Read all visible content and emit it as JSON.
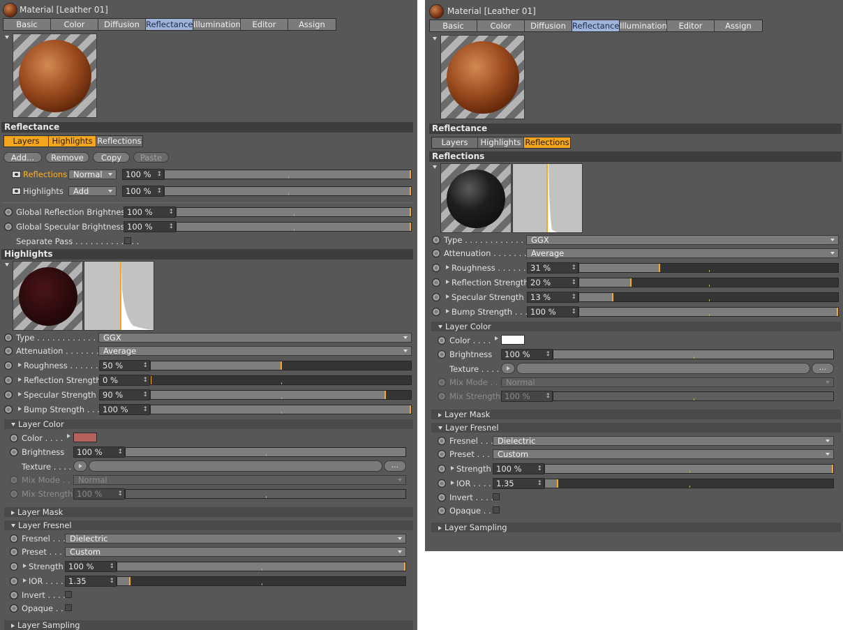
{
  "material_title": "Material [Leather 01]",
  "tabs": [
    "Basic",
    "Color",
    "Diffusion",
    "Reflectance",
    "Illumination",
    "Editor",
    "Assign"
  ],
  "active_tab": "Reflectance",
  "section_reflectance": "Reflectance",
  "subtabs": [
    "Layers",
    "Highlights",
    "Reflections"
  ],
  "layer_buttons": [
    "Add...",
    "Remove",
    "Copy",
    "Paste"
  ],
  "layers": [
    {
      "name": "Reflections",
      "blend": "Normal",
      "value": "100 %"
    },
    {
      "name": "Highlights",
      "blend": "Add",
      "value": "100 %"
    }
  ],
  "global": [
    {
      "label": "Global Reflection Brightness",
      "value": "100 %"
    },
    {
      "label": "Global Specular Brightness",
      "value": "100 %"
    }
  ],
  "separate_pass": "Separate Pass . . . . . . . . . . . . .",
  "left_layer": {
    "title": "Highlights",
    "type_label": "Type . . . . . . . . . . . . . . .",
    "type": "GGX",
    "attenuation_label": "Attenuation . . . . . . . . .",
    "attenuation": "Average",
    "params": [
      {
        "label": "Roughness . . . . . . . .",
        "value": "50 %",
        "level": 0.5
      },
      {
        "label": "Reflection Strength",
        "value": "0 %",
        "level": 0
      },
      {
        "label": "Specular Strength",
        "value": "90 %",
        "level": 0.9
      },
      {
        "label": "Bump Strength . . . .",
        "value": "100 %",
        "level": 1
      }
    ],
    "color_hex": "#b5615d"
  },
  "right_layer": {
    "title": "Reflections",
    "type_label": "Type . . . . . . . . . . . . . . .",
    "type": "GGX",
    "attenuation_label": "Attenuation . . . . . . . . .",
    "attenuation": "Average",
    "params": [
      {
        "label": "Roughness . . . . . . . .",
        "value": "31 %",
        "level": 0.31
      },
      {
        "label": "Reflection Strength",
        "value": "20 %",
        "level": 0.2
      },
      {
        "label": "Specular Strength",
        "value": "13 %",
        "level": 0.13
      },
      {
        "label": "Bump Strength . . . .",
        "value": "100 %",
        "level": 1
      }
    ],
    "color_hex": "#ffffff"
  },
  "layer_color": {
    "title": "Layer Color",
    "color_label": "Color . . . .",
    "brightness_label": "Brightness",
    "brightness": "100 %",
    "texture_label": "Texture . . . .",
    "texture_btn": "...",
    "mix_mode_label": "Mix Mode . .",
    "mix_mode": "Normal",
    "mix_strength_label": "Mix Strength",
    "mix_strength": "100 %"
  },
  "layer_mask": "Layer Mask",
  "layer_fresnel": {
    "title": "Layer Fresnel",
    "fresnel_label": "Fresnel . . .",
    "fresnel": "Dielectric",
    "preset_label": "Preset . . . .",
    "preset": "Custom",
    "strength_label": "Strength",
    "strength": "100 %",
    "ior_label": "IOR . . . . .",
    "ior": "1.35",
    "invert_label": "Invert . . . .",
    "opaque_label": "Opaque . ."
  },
  "layer_sampling": "Layer Sampling",
  "colors": {
    "accent": "#f4a71c",
    "tab_active": "#9fb4d8"
  },
  "icons": [
    "material-ball-icon",
    "eye-icon",
    "dropdown-arrow-icon",
    "radio-icon",
    "triangle-expand-icon"
  ]
}
